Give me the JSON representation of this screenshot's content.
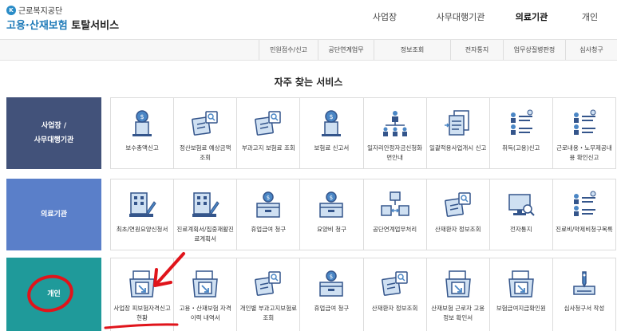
{
  "header": {
    "logo_org": "근로복지공단",
    "logo_mark": "K",
    "logo_title_blue": "고용·산재보험",
    "logo_title_dark": " 토탈서비스",
    "gnb": [
      {
        "label": "사업장",
        "active": false
      },
      {
        "label": "사무대행기관",
        "active": false
      },
      {
        "label": "의료기관",
        "active": true
      },
      {
        "label": "개인",
        "active": false
      }
    ]
  },
  "subnav": [
    "민원접수/신고",
    "공단연계업무",
    "정보조회",
    "전자통지",
    "업무상질병판정",
    "심사청구"
  ],
  "section_title": "자주 찾는 서비스",
  "categories": [
    {
      "label": "사업장 /\n사무대행기관",
      "tiles": [
        {
          "label": "보수총액신고",
          "icon": "coin-doc-icon"
        },
        {
          "label": "정산보험료 예상금액 조회",
          "icon": "doc-search-icon"
        },
        {
          "label": "부과고지 보험료 조회",
          "icon": "doc-search-icon"
        },
        {
          "label": "보험료 신고서",
          "icon": "coin-doc-icon"
        },
        {
          "label": "일자리안정자금신청화면안내",
          "icon": "org-chart-icon"
        },
        {
          "label": "일괄적용사업개시 신고",
          "icon": "docs-stack-icon"
        },
        {
          "label": "취득(고용)신고",
          "icon": "people-list-icon"
        },
        {
          "label": "근로내용・노무제공내용 확인신고",
          "icon": "people-list-icon"
        }
      ]
    },
    {
      "label": "의료기관",
      "tiles": [
        {
          "label": "최초/연원요양신청서",
          "icon": "hospital-pen-icon"
        },
        {
          "label": "진료계획서/집중재활진료계획서",
          "icon": "hospital-pen-icon"
        },
        {
          "label": "휴업급여 청구",
          "icon": "coin-box-icon"
        },
        {
          "label": "요양비 청구",
          "icon": "coin-box-icon"
        },
        {
          "label": "공단연계업무처리",
          "icon": "link-folders-icon"
        },
        {
          "label": "산재환자 정보조회",
          "icon": "doc-search-icon"
        },
        {
          "label": "전자통지",
          "icon": "monitor-search-icon"
        },
        {
          "label": "진료비/약제비청구목록",
          "icon": "people-list-icon"
        }
      ]
    },
    {
      "label": "개인",
      "tiles": [
        {
          "label": "사업장 피보험자격신고현황",
          "icon": "download-doc-icon"
        },
        {
          "label": "고용・산재보험 자격 이력 내역서",
          "icon": "download-doc-icon"
        },
        {
          "label": "개인별 부과고지보험료 조회",
          "icon": "doc-search-icon"
        },
        {
          "label": "휴업급여 청구",
          "icon": "coin-box-icon"
        },
        {
          "label": "산재환자 정보조회",
          "icon": "doc-search-icon"
        },
        {
          "label": "산재보험 근로자 고용정보 확인서",
          "icon": "download-doc-icon"
        },
        {
          "label": "보험급여지급확인원",
          "icon": "download-doc-icon"
        },
        {
          "label": "심사청구서 작성",
          "icon": "pen-doc-icon"
        }
      ]
    }
  ],
  "colors": {
    "accent_blue": "#1e7ab8",
    "cat1": "#42527a",
    "cat2": "#5a7fc9",
    "cat3": "#1f9a9a",
    "annotation": "#e0141b"
  }
}
